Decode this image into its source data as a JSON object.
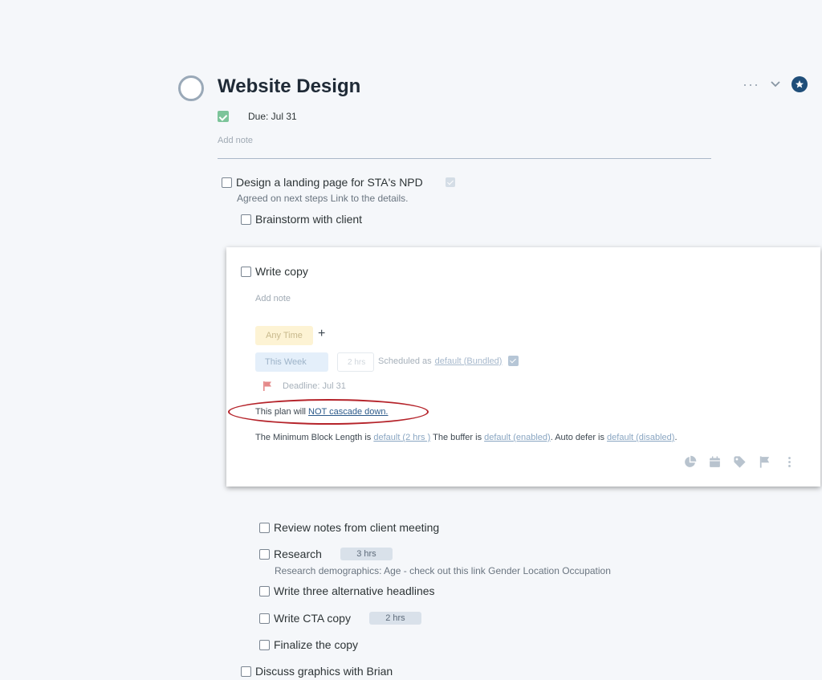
{
  "project": {
    "title": "Website Design",
    "due": "Due: Jul 31",
    "note_placeholder": "Add note"
  },
  "header_actions": [
    "more-icon",
    "chevron-down-icon",
    "star-icon"
  ],
  "tasks": [
    {
      "label": "Design a landing page for STA's NPD",
      "note": "Agreed on next steps Link to the details."
    },
    {
      "label": "Brainstorm with client"
    }
  ],
  "expanded_task": {
    "label": "Write copy",
    "note_placeholder": "Add note",
    "when_chip": "Any Time",
    "plus": "+",
    "week_chip": "This Week",
    "duration_placeholder": "2 hrs",
    "scheduled_prefix": "Scheduled as",
    "scheduled_link": "default (Bundled)",
    "deadline": "Deadline: Jul 31",
    "cascade_prefix": "This plan will",
    "cascade_link": "NOT cascade down.",
    "min_block_prefix": "The Minimum Block Length is",
    "min_block_link": "default (2 hrs )",
    "buffer_prefix": "The buffer is",
    "buffer_link": "default (enabled)",
    "auto_defer_prefix": "Auto defer is",
    "auto_defer_link": "default (disabled)",
    "period": ".",
    "icons": [
      "pie-chart-icon",
      "calendar-icon",
      "tag-icon",
      "flag-icon",
      "more-vertical-icon"
    ]
  },
  "subtasks": [
    {
      "label": "Review notes from client meeting"
    },
    {
      "label": "Research",
      "hours": "3 hrs",
      "note": "Research demographics: Age - check out this link Gender Location Occupation"
    },
    {
      "label": "Write three alternative headlines"
    },
    {
      "label": "Write CTA copy",
      "hours": "2 hrs"
    },
    {
      "label": "Finalize the copy"
    }
  ],
  "last_task": {
    "label": "Discuss graphics with Brian"
  },
  "colors": {
    "title": "#1f2a36",
    "accent": "#1f4e79",
    "annotation_oval": "#b5232a",
    "deadline_flag": "#e58a8a"
  }
}
